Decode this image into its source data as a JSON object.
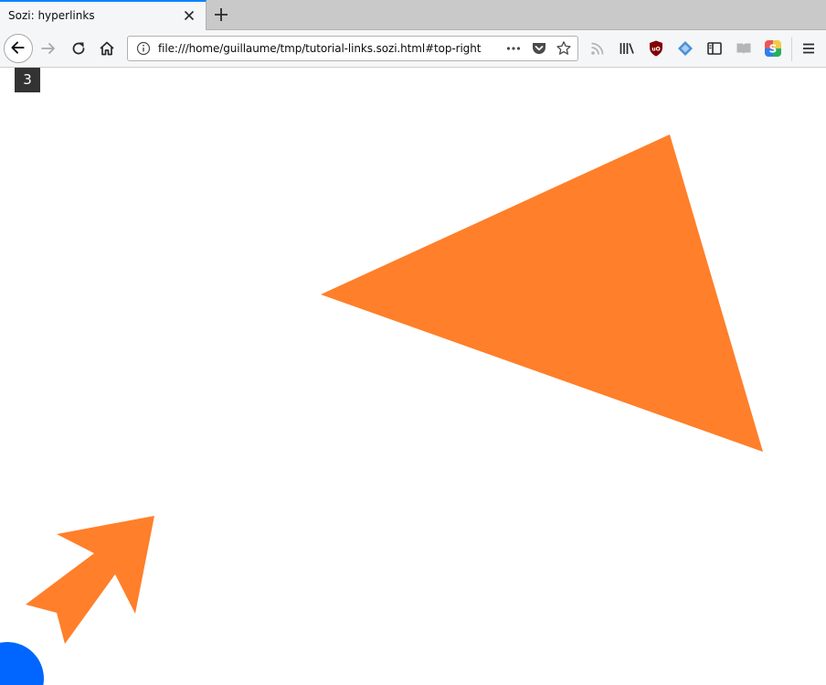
{
  "tab": {
    "title": "Sozi: hyperlinks"
  },
  "toolbar": {
    "url": "file:///home/guillaume/tmp/tutorial-links.sozi.html#top-right"
  },
  "content": {
    "frame_number": "3"
  },
  "colors": {
    "shape_fill": "#ff7f2a",
    "circle_fill": "#0066ff",
    "tab_accent": "#0a84ff"
  }
}
